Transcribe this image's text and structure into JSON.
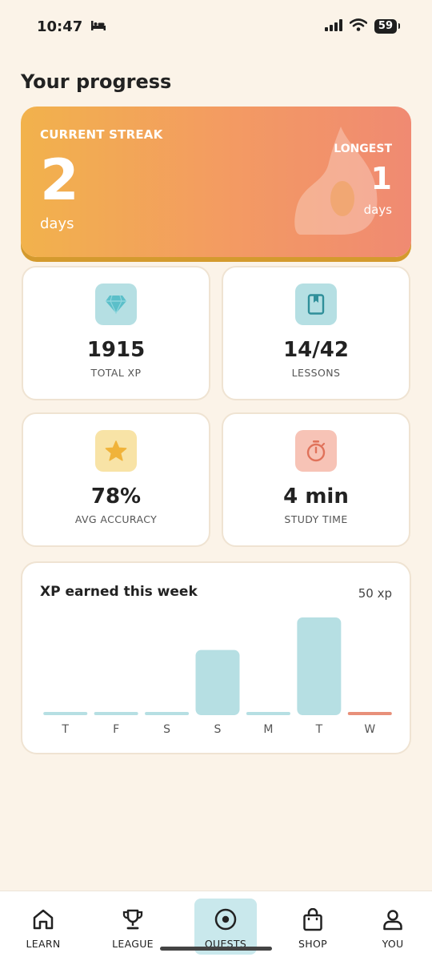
{
  "status_bar": {
    "time": "10:47",
    "battery": "59"
  },
  "page": {
    "title": "Your progress"
  },
  "streak": {
    "label": "CURRENT STREAK",
    "value": "2",
    "unit": "days",
    "longest_label": "LONGEST",
    "longest_value": "1",
    "longest_unit": "days"
  },
  "stats": [
    {
      "value": "1915",
      "label": "TOTAL XP",
      "icon": "diamond-icon",
      "icon_bg": "#b5dfe3",
      "icon_color": "#5bbfc9"
    },
    {
      "value": "14/42",
      "label": "LESSONS",
      "icon": "book-icon",
      "icon_bg": "#b5dfe3",
      "icon_color": "#2f8f9a"
    },
    {
      "value": "78%",
      "label": "AVG ACCURACY",
      "icon": "star-icon",
      "icon_bg": "#f8e3a6",
      "icon_color": "#f0b33a"
    },
    {
      "value": "4 min",
      "label": "STUDY TIME",
      "icon": "stopwatch-icon",
      "icon_bg": "#f7c3b6",
      "icon_color": "#e0725a"
    }
  ],
  "chart": {
    "title": "XP earned this week",
    "total": "50 xp"
  },
  "chart_data": {
    "type": "bar",
    "title": "XP earned this week",
    "categories": [
      "T",
      "F",
      "S",
      "S",
      "M",
      "T",
      "W"
    ],
    "values": [
      0,
      0,
      0,
      20,
      0,
      30,
      0
    ],
    "highlight_index": 6,
    "colors": {
      "bar": "#b6dfe3",
      "highlight": "#e8907a"
    }
  },
  "nav": {
    "items": [
      {
        "label": "LEARN",
        "icon": "home-icon",
        "active": false
      },
      {
        "label": "LEAGUE",
        "icon": "trophy-icon",
        "active": false
      },
      {
        "label": "QUESTS",
        "icon": "target-icon",
        "active": true
      },
      {
        "label": "SHOP",
        "icon": "shopping-bag-icon",
        "active": false
      },
      {
        "label": "YOU",
        "icon": "user-icon",
        "active": false
      }
    ]
  }
}
